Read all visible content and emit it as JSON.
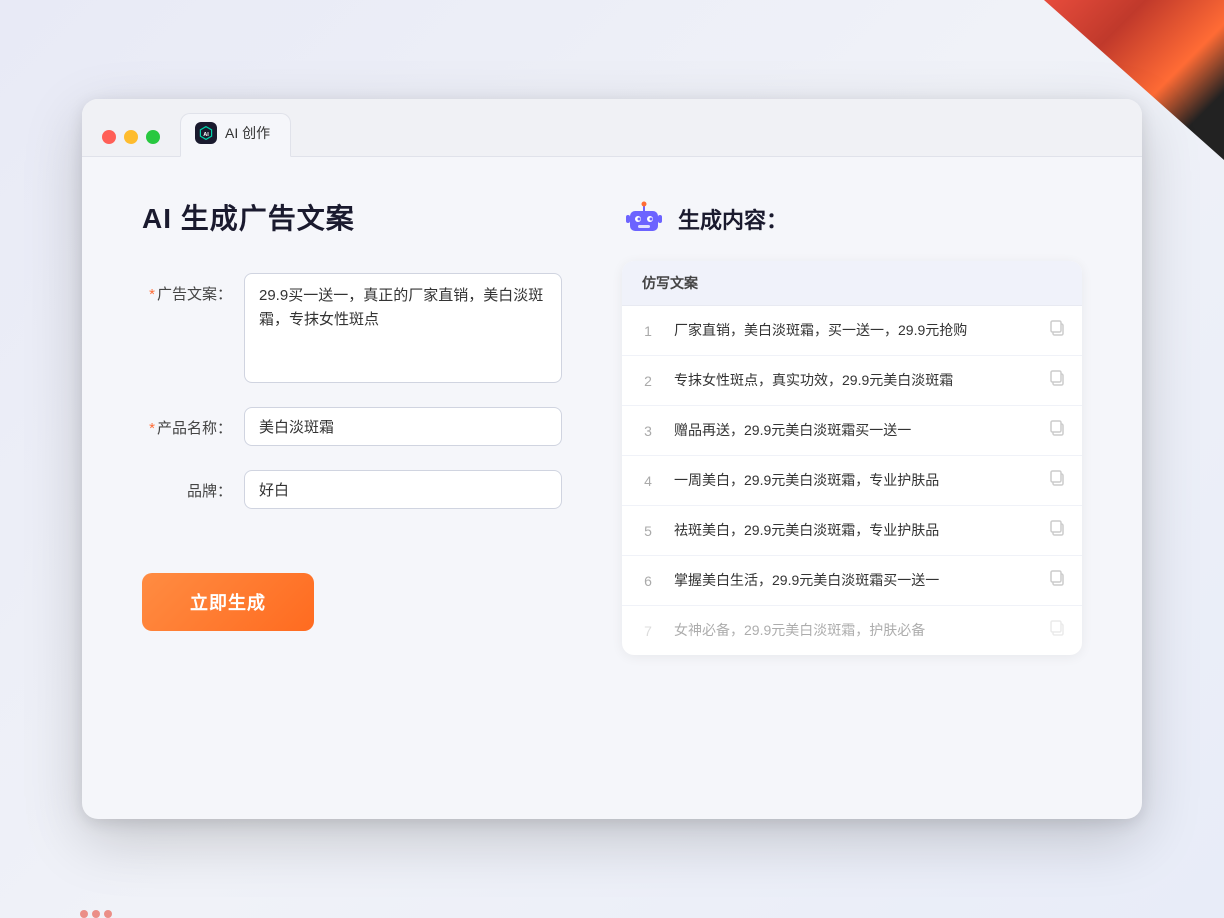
{
  "window": {
    "tab_title": "AI 创作"
  },
  "page": {
    "title": "AI 生成广告文案",
    "form": {
      "ad_label": "广告文案：",
      "ad_required": "*",
      "ad_value": "29.9买一送一，真正的厂家直销，美白淡斑霜，专抹女性斑点",
      "product_label": "产品名称：",
      "product_required": "*",
      "product_value": "美白淡斑霜",
      "brand_label": "品牌：",
      "brand_value": "好白",
      "generate_btn": "立即生成"
    },
    "result": {
      "header_title": "生成内容：",
      "table_col": "仿写文案",
      "rows": [
        {
          "num": "1",
          "text": "厂家直销，美白淡斑霜，买一送一，29.9元抢购",
          "faded": false
        },
        {
          "num": "2",
          "text": "专抹女性斑点，真实功效，29.9元美白淡斑霜",
          "faded": false
        },
        {
          "num": "3",
          "text": "赠品再送，29.9元美白淡斑霜买一送一",
          "faded": false
        },
        {
          "num": "4",
          "text": "一周美白，29.9元美白淡斑霜，专业护肤品",
          "faded": false
        },
        {
          "num": "5",
          "text": "祛斑美白，29.9元美白淡斑霜，专业护肤品",
          "faded": false
        },
        {
          "num": "6",
          "text": "掌握美白生活，29.9元美白淡斑霜买一送一",
          "faded": false
        },
        {
          "num": "7",
          "text": "女神必备，29.9元美白淡斑霜，护肤必备",
          "faded": true
        }
      ]
    }
  },
  "colors": {
    "accent_orange": "#ff6b20",
    "accent_purple": "#7b68ee",
    "required_star": "#ff6b35"
  }
}
